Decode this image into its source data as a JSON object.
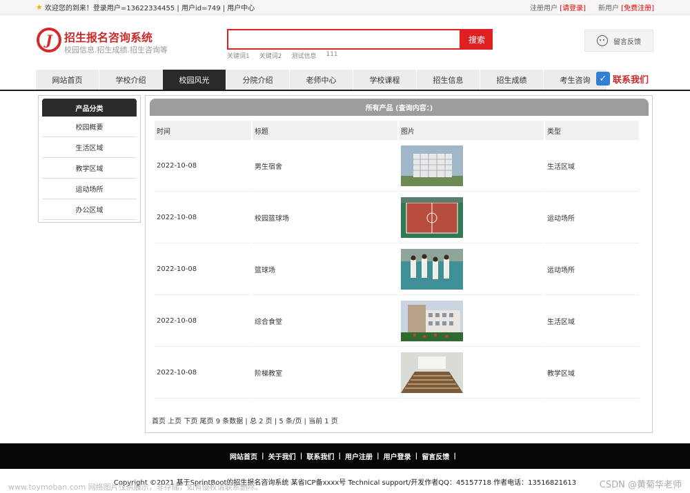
{
  "topbar": {
    "welcome": "欢迎您的到来！登录用户=13622334455 | 用户id=749 | 用户中心",
    "register_user_label": "注册用户",
    "register_user_link": "[请登录]",
    "new_user_label": "新用户",
    "new_user_link": "[免费注册]"
  },
  "header": {
    "logo_letter": "J",
    "title": "招生报名咨询系统",
    "subtitle": "校园信息.招生成绩.招生咨询等",
    "search_placeholder": "",
    "search_button": "搜索",
    "keywords": [
      "关键词1",
      "关键词2",
      "测试信息",
      "111"
    ],
    "feedback": "留言反馈"
  },
  "nav": {
    "items": [
      "网站首页",
      "学校介绍",
      "校园风光",
      "分院介绍",
      "老师中心",
      "学校课程",
      "招生信息",
      "招生成绩",
      "考生咨询"
    ],
    "active_index": 2,
    "contact": "联系我们"
  },
  "sidebar": {
    "title": "产品分类",
    "items": [
      "校园概要",
      "生活区域",
      "教学区域",
      "运动场所",
      "办公区域"
    ]
  },
  "main": {
    "title": "所有产品 (查询内容：)",
    "columns": [
      "时间",
      "标题",
      "图片",
      "类型"
    ],
    "rows": [
      {
        "date": "2022-10-08",
        "title": "男生宿舍",
        "image": "building-photo",
        "type": "生活区域"
      },
      {
        "date": "2022-10-08",
        "title": "校园篮球场",
        "image": "basketball-court-photo",
        "type": "运动场所"
      },
      {
        "date": "2022-10-08",
        "title": "篮球场",
        "image": "people-on-court-photo",
        "type": "运动场所"
      },
      {
        "date": "2022-10-08",
        "title": "综合食堂",
        "image": "canteen-photo",
        "type": "生活区域"
      },
      {
        "date": "2022-10-08",
        "title": "阶梯教室",
        "image": "lecture-hall-photo",
        "type": "教学区域"
      }
    ],
    "pager": "首页 上页 下页 尾页     9 条数据 | 总 2 页 | 5 条/页 | 当前 1 页"
  },
  "footer": {
    "links": [
      "网站首页",
      "关于我们",
      "联系我们",
      "用户注册",
      "用户登录",
      "留言反馈"
    ],
    "copyright": "Copyright ©2021 基于SprintBoot的招生报名咨询系统    某省ICP备xxxx号    Technical support/开发作者QQ：45157718    作者电话：13516821613"
  },
  "watermark": {
    "left": "www.toymoban.com 网络图片仅供展示，非存储，如有侵权请联系删除。",
    "right": "CSDN @黄菊华老师"
  }
}
